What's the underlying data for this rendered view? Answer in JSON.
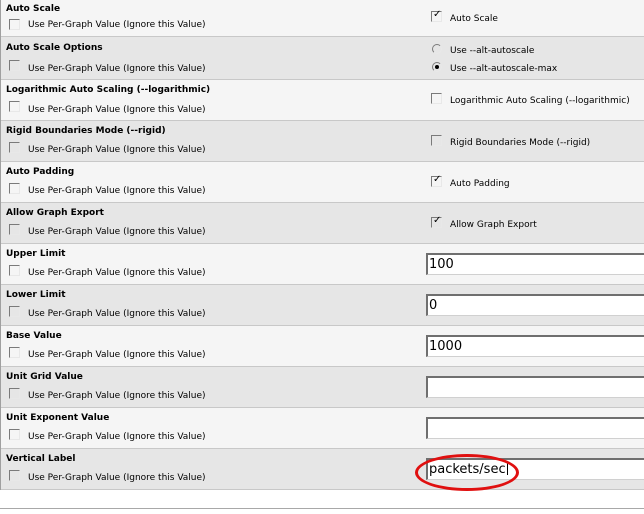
{
  "per_graph_label": "Use Per-Graph Value (Ignore this Value)",
  "rows": {
    "auto_scale": {
      "title": "Auto Scale",
      "option_label": "Auto Scale",
      "checked": true
    },
    "auto_scale_options": {
      "title": "Auto Scale Options",
      "options": [
        {
          "label": "Use --alt-autoscale",
          "selected": false
        },
        {
          "label": "Use --alt-autoscale-max",
          "selected": true
        }
      ]
    },
    "log_scaling": {
      "title": "Logarithmic Auto Scaling (--logarithmic)",
      "option_label": "Logarithmic Auto Scaling (--logarithmic)",
      "checked": false
    },
    "rigid": {
      "title": "Rigid Boundaries Mode (--rigid)",
      "option_label": "Rigid Boundaries Mode (--rigid)",
      "checked": false
    },
    "auto_padding": {
      "title": "Auto Padding",
      "option_label": "Auto Padding",
      "checked": true
    },
    "graph_export": {
      "title": "Allow Graph Export",
      "option_label": "Allow Graph Export",
      "checked": true
    },
    "upper_limit": {
      "title": "Upper Limit",
      "value": "100"
    },
    "lower_limit": {
      "title": "Lower Limit",
      "value": "0"
    },
    "base_value": {
      "title": "Base Value",
      "value": "1000"
    },
    "unit_grid": {
      "title": "Unit Grid Value",
      "value": ""
    },
    "unit_exponent": {
      "title": "Unit Exponent Value",
      "value": ""
    },
    "vertical_label": {
      "title": "Vertical Label",
      "value": "packets/sec"
    }
  },
  "colors": {
    "highlight_ellipse": "#e01010",
    "row_odd": "#f5f5f5",
    "row_even": "#e6e6e6"
  }
}
